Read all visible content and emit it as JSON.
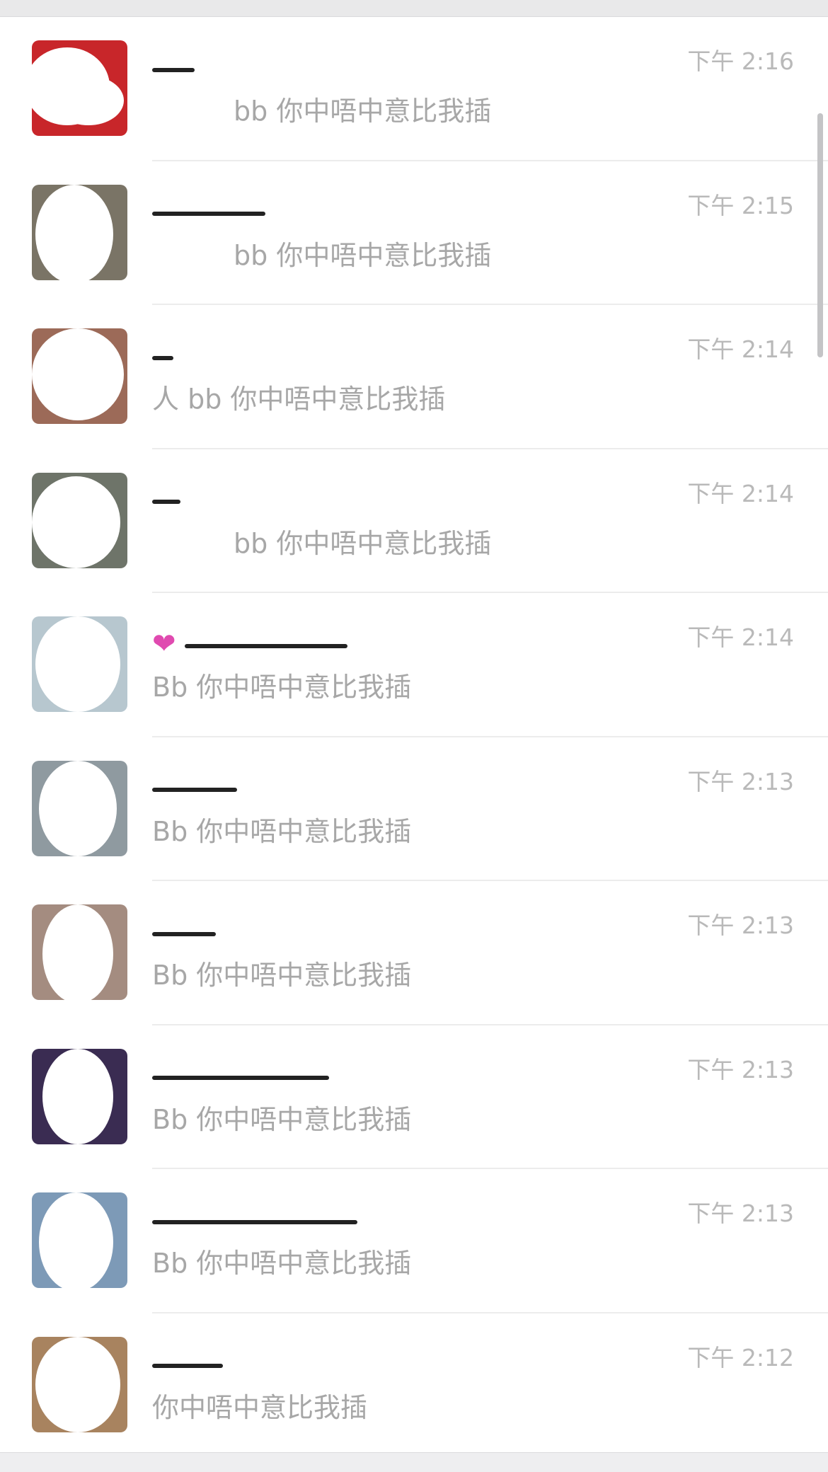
{
  "chats": [
    {
      "preview": "bb 你中唔中意比我插",
      "time": "下午 2:16",
      "avatar_color": "#c8262a"
    },
    {
      "preview": "bb 你中唔中意比我插",
      "time": "下午 2:15",
      "avatar_color": "#7a7466"
    },
    {
      "preview": "人 bb 你中唔中意比我插",
      "time": "下午 2:14",
      "avatar_color": "#9c6a58"
    },
    {
      "preview": "bb 你中唔中意比我插",
      "time": "下午 2:14",
      "avatar_color": "#6e7469"
    },
    {
      "preview": "Bb 你中唔中意比我插",
      "time": "下午 2:14",
      "avatar_color": "#b7c7cf"
    },
    {
      "preview": "Bb 你中唔中意比我插",
      "time": "下午 2:13",
      "avatar_color": "#8f9aa0"
    },
    {
      "preview": "Bb 你中唔中意比我插",
      "time": "下午 2:13",
      "avatar_color": "#a48c80"
    },
    {
      "preview": "Bb 你中唔中意比我插",
      "time": "下午 2:13",
      "avatar_color": "#3a2c52"
    },
    {
      "preview": "Bb 你中唔中意比我插",
      "time": "下午 2:13",
      "avatar_color": "#7d9ab7"
    },
    {
      "preview": "你中唔中意比我插",
      "time": "下午 2:12",
      "avatar_color": "#a8835f"
    }
  ]
}
